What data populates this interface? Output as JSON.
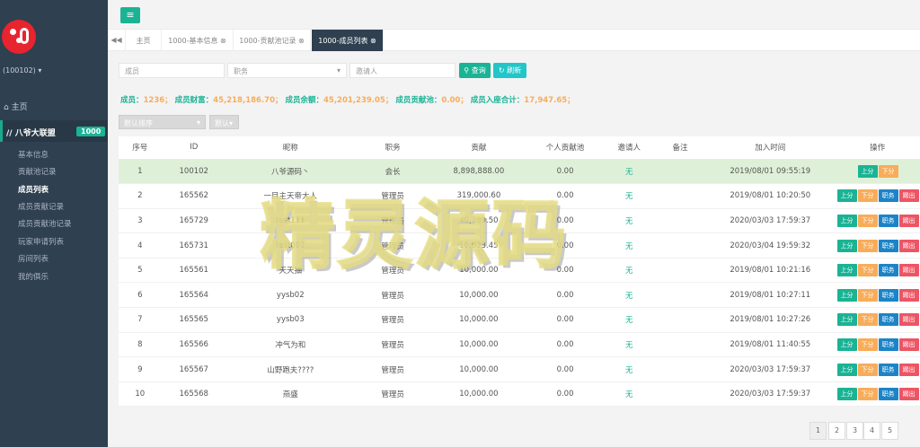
{
  "sidebar": {
    "user": "(100102) ▾",
    "home": "主页",
    "group": {
      "label": "八爷大联盟",
      "badge": "1000"
    },
    "items": [
      {
        "label": "基本信息"
      },
      {
        "label": "贡献池记录"
      },
      {
        "label": "成员列表"
      },
      {
        "label": "成员贡献记录"
      },
      {
        "label": "成员贡献池记录"
      },
      {
        "label": "玩家申请列表"
      },
      {
        "label": "房间列表"
      },
      {
        "label": "我的俱乐"
      }
    ]
  },
  "tabs": [
    {
      "label": "主页"
    },
    {
      "label": "1000-基本信息 ⊗"
    },
    {
      "label": "1000-贡献池记录 ⊗"
    },
    {
      "label": "1000-成员列表 ⊗"
    }
  ],
  "filters": {
    "member_placeholder": "成员",
    "role_placeholder": "职务",
    "inviter_placeholder": "邀请人",
    "query_label": "查询",
    "refresh_label": "刷新",
    "sort_label": "默认排序",
    "default_label": "默认"
  },
  "stats": {
    "member_label": "成员：",
    "member_value": "1236；",
    "wealth_label": "成员财富：",
    "wealth_value": "45,218,186.70；",
    "balance_label": "成员余额：",
    "balance_value": "45,201,239.05；",
    "pool_label": "成员贡献池：",
    "pool_value": "0.00；",
    "seat_label": "成员入座合计：",
    "seat_value": "17,947.65；"
  },
  "table": {
    "headers": [
      "序号",
      "ID",
      "昵称",
      "职务",
      "贡献",
      "个人贡献池",
      "邀请人",
      "备注",
      "加入时间",
      "操作"
    ],
    "rows": [
      [
        "1",
        "100102",
        "八爷源码丶",
        "会长",
        "8,898,888.00",
        "0.00",
        "无",
        "",
        "2019/08/01 09:55:19"
      ],
      [
        "2",
        "165562",
        "一目主天帝大人",
        "管理员",
        "319,000.60",
        "0.00",
        "无",
        "",
        "2019/08/01 10:20:50"
      ],
      [
        "3",
        "165729",
        "test111",
        "管理员",
        "40,789.50",
        "0.00",
        "无",
        "",
        "2020/03/03 17:59:37"
      ],
      [
        "4",
        "165731",
        "test007",
        "管理员",
        "10,023.45",
        "0.00",
        "无",
        "",
        "2020/03/04 19:59:32"
      ],
      [
        "5",
        "165561",
        "天天抽",
        "管理员",
        "10,000.00",
        "0.00",
        "无",
        "",
        "2019/08/01 10:21:16"
      ],
      [
        "6",
        "165564",
        "yysb02",
        "管理员",
        "10,000.00",
        "0.00",
        "无",
        "",
        "2019/08/01 10:27:11"
      ],
      [
        "7",
        "165565",
        "yysb03",
        "管理员",
        "10,000.00",
        "0.00",
        "无",
        "",
        "2019/08/01 10:27:26"
      ],
      [
        "8",
        "165566",
        "冲气为和",
        "管理员",
        "10,000.00",
        "0.00",
        "无",
        "",
        "2019/08/01 11:40:55"
      ],
      [
        "9",
        "165567",
        "山野跑夫????",
        "管理员",
        "10,000.00",
        "0.00",
        "无",
        "",
        "2020/03/03 17:59:37"
      ],
      [
        "10",
        "165568",
        "燕盛",
        "管理员",
        "10,000.00",
        "0.00",
        "无",
        "",
        "2020/03/03 17:59:37"
      ]
    ],
    "actions": {
      "up": "上分",
      "down": "下分",
      "role": "职务",
      "kick": "踢出"
    }
  },
  "pagination": [
    "1",
    "2",
    "3",
    "4",
    "5"
  ],
  "watermark": "精灵源码",
  "colors": {
    "accent": "#1ab394",
    "sidebar": "#2f4050",
    "warning": "#f8ac59",
    "primary": "#1c84c6",
    "danger": "#ed5565"
  }
}
